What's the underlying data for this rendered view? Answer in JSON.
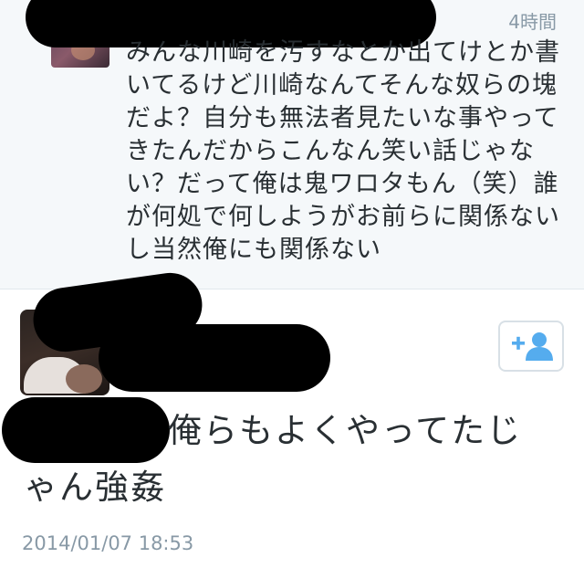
{
  "reply_tweet": {
    "time": "4時間",
    "text": "みんな川崎を汚すなとか出てけとか書いてるけど川崎なんてそんな奴らの塊だよ？自分も無法者見たいな事やってきたんだからこんなん笑い話じゃない？だって俺は鬼ワロタもん（笑）誰が何処で何しようがお前らに関係ないし当然俺にも関係ない"
  },
  "main_tweet": {
    "text": "俺らもよくやってたじゃん強姦",
    "timestamp": "2014/01/07 18:53",
    "follow_icon": "add-user-icon"
  },
  "colors": {
    "accent": "#55acee",
    "text": "#292f33",
    "muted": "#8899a6",
    "reply_bg": "#f5f8fa",
    "redaction": "#000000"
  }
}
